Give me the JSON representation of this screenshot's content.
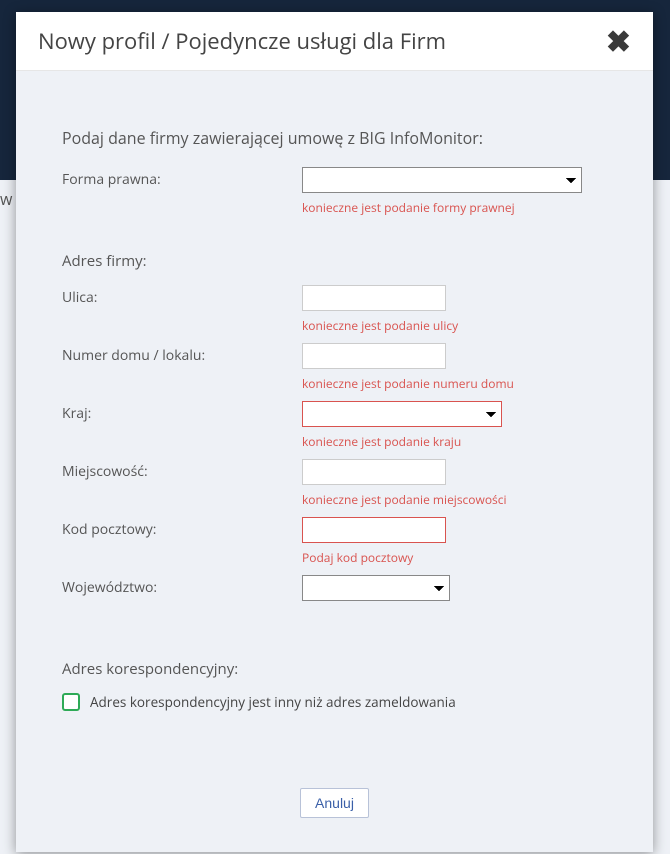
{
  "modal": {
    "title": "Nowy profil / Pojedyncze usługi dla Firm",
    "section1_title": "Podaj dane firmy zawierającej umowę z BIG InfoMonitor:",
    "section2_title": "Adres firmy:",
    "section3_title": "Adres korespondencyjny:",
    "fields": {
      "forma_prawna": {
        "label": "Forma prawna:",
        "value": "",
        "error": "konieczne jest podanie formy prawnej"
      },
      "ulica": {
        "label": "Ulica:",
        "value": "",
        "error": "konieczne jest podanie ulicy"
      },
      "numer_domu": {
        "label": "Numer domu / lokalu:",
        "value": "",
        "error": "konieczne jest podanie numeru domu"
      },
      "kraj": {
        "label": "Kraj:",
        "value": "",
        "error": "konieczne jest podanie kraju"
      },
      "miejscowosc": {
        "label": "Miejscowość:",
        "value": "",
        "error": "konieczne jest podanie miejscowości"
      },
      "kod_pocztowy": {
        "label": "Kod pocztowy:",
        "value": "",
        "error": "Podaj kod pocztowy"
      },
      "wojewodztwo": {
        "label": "Województwo:",
        "value": ""
      }
    },
    "checkbox_label": "Adres korespondencyjny jest inny niż adres zameldowania",
    "cancel_label": "Anuluj"
  },
  "colors": {
    "error": "#d9534f",
    "accent": "#2eaa57",
    "link": "#3a5fa8"
  }
}
